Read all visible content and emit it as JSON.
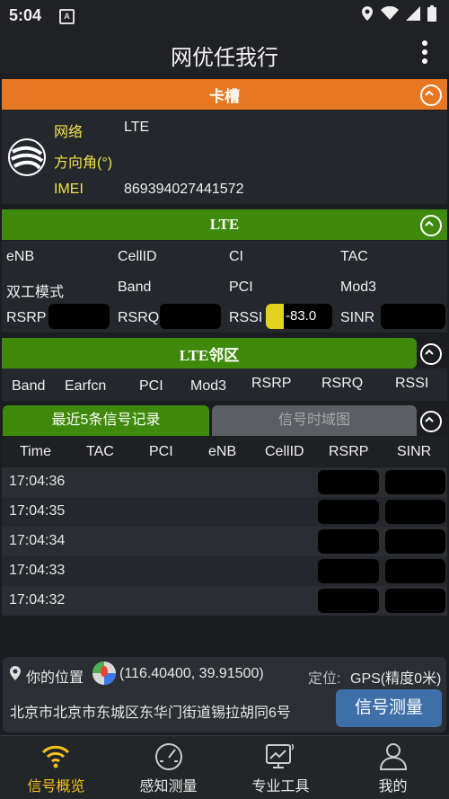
{
  "status": {
    "time": "5:04"
  },
  "appbar": {
    "title": "网优任我行"
  },
  "sim": {
    "header": "卡槽",
    "labels": [
      "网络",
      "方向角(°)",
      "IMEI"
    ],
    "values": [
      "LTE",
      "",
      "869394027441572"
    ]
  },
  "lte": {
    "header": "LTE",
    "row1": [
      "eNB",
      "CellID",
      "CI",
      "TAC"
    ],
    "row2": [
      "双工模式",
      "Band",
      "PCI",
      "Mod3"
    ],
    "row3": [
      "RSRP",
      "RSRQ",
      "RSSI",
      "SINR"
    ],
    "rssi_value": "-83.0"
  },
  "neighbor": {
    "header": "LTE邻区",
    "columns": [
      "Band",
      "Earfcn",
      "PCI",
      "Mod3",
      "RSRP",
      "RSRQ",
      "RSSI"
    ]
  },
  "records": {
    "tab_active": "最近5条信号记录",
    "tab_inactive": "信号时域图",
    "columns": [
      "Time",
      "TAC",
      "PCI",
      "eNB",
      "CellID",
      "RSRP",
      "SINR"
    ],
    "rows": [
      "17:04:36",
      "17:04:35",
      "17:04:34",
      "17:04:33",
      "17:04:32"
    ]
  },
  "location": {
    "label": "你的位置",
    "coords": "(116.40400, 39.91500)",
    "mode": "定位:",
    "gps": "GPS(精度0米)",
    "address": "北京市北京市东城区东华门街道锡拉胡同6号",
    "measure_button": "信号测量"
  },
  "tabs": [
    "信号概览",
    "感知测量",
    "专业工具",
    "我的"
  ],
  "colors": {
    "orange": "#e87722",
    "green": "#3f8a0c",
    "active_tab": "#f2c21b"
  }
}
